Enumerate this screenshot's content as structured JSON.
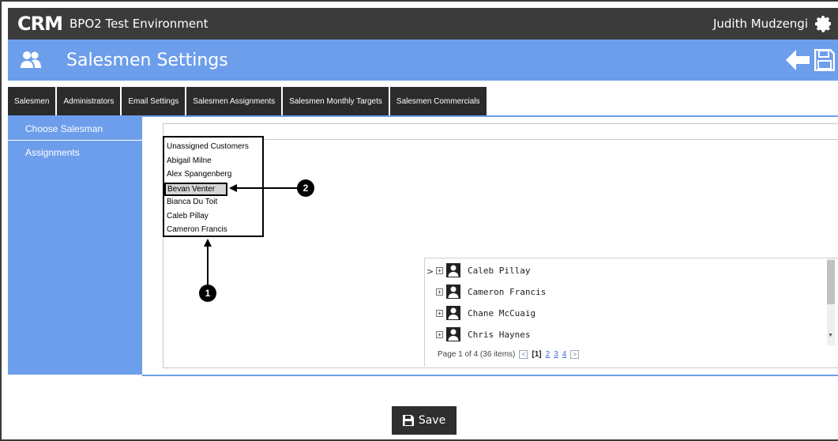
{
  "topbar": {
    "logo": "CRM",
    "title": "BPO2 Test Environment",
    "user": "Judith Mudzengi"
  },
  "header": {
    "title": "Salesmen Settings"
  },
  "tabs": [
    {
      "label": "Salesmen"
    },
    {
      "label": "Administrators"
    },
    {
      "label": "Email Settings"
    },
    {
      "label": "Salesmen Assignments"
    },
    {
      "label": "Salesmen Monthly Targets"
    },
    {
      "label": "Salesmen Commercials"
    }
  ],
  "sidebar": {
    "items": [
      {
        "label": "Choose Salesman"
      },
      {
        "label": "Assignments"
      }
    ]
  },
  "dropdown": {
    "items": [
      {
        "label": "Unassigned Customers"
      },
      {
        "label": "Abigail Milne"
      },
      {
        "label": "Alex Spangenberg"
      },
      {
        "label": "Bevan Venter"
      },
      {
        "label": "Bianca Du Toit"
      },
      {
        "label": "Caleb Pillay"
      },
      {
        "label": "Cameron Francis"
      }
    ],
    "selected": "Bevan Venter"
  },
  "callouts": [
    {
      "label": "1"
    },
    {
      "label": "2"
    }
  ],
  "grid": {
    "pointer": ">",
    "rows": [
      {
        "name": "Caleb Pillay"
      },
      {
        "name": "Cameron Francis"
      },
      {
        "name": "Chane McCuaig"
      },
      {
        "name": "Chris Haynes"
      }
    ],
    "pager": {
      "summary": "Page 1 of 4 (36 items)",
      "current": "[1]",
      "pages": [
        "2",
        "3",
        "4"
      ]
    }
  },
  "actions": {
    "save_label": "Save"
  },
  "colors": {
    "topbar": "#3b3b3b",
    "accent": "#6d9eeb",
    "tab": "#2b2b2b"
  }
}
